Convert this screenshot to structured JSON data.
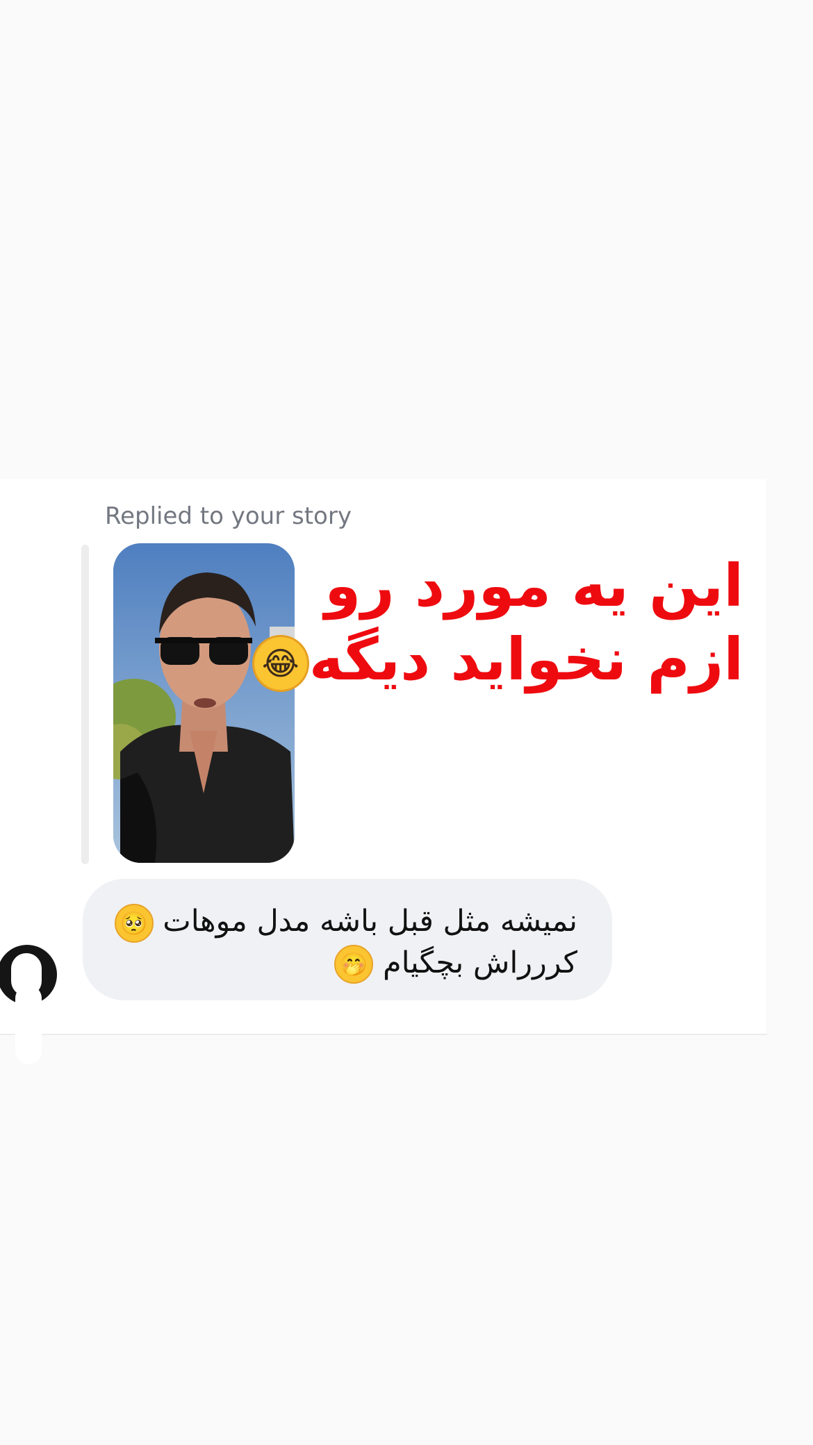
{
  "reply": {
    "caption": "Replied to your story"
  },
  "story": {
    "line_1": "این یه مورد رو",
    "line_2": "ازم نخواید دیگه",
    "emoji_name": "face-with-tears-of-joy",
    "emoji_glyph": "😂"
  },
  "message": {
    "line_1": "نمیشه مثل قبل باشه مدل موهات",
    "line_1_emoji_name": "pleading-face",
    "line_1_emoji_glyph": "🥺",
    "line_2": "کررراش بچگیام",
    "line_2_emoji_name": "face-with-hand-over-mouth",
    "line_2_emoji_glyph": "🤭"
  },
  "colors": {
    "story_text": "#ee0b10",
    "bubble_bg": "#f0f1f4",
    "caption": "#737780",
    "page_bg": "#fafafa"
  },
  "icons": {
    "avatar": "avatar-icon"
  }
}
